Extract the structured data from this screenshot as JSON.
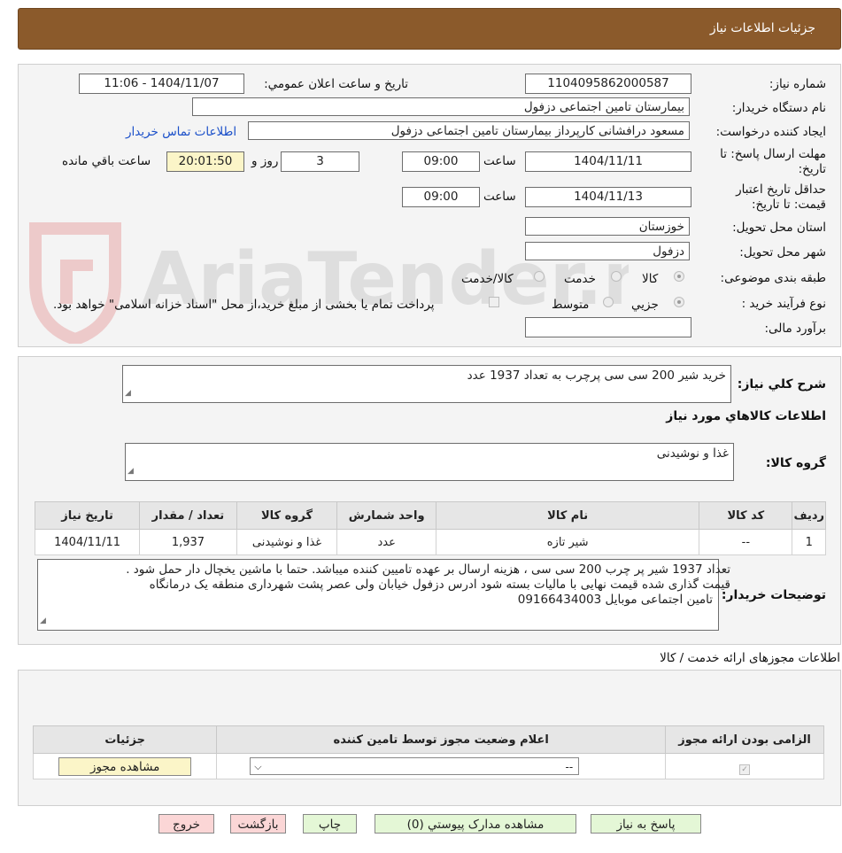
{
  "header": {
    "title": "جزئیات اطلاعات نیاز"
  },
  "fields": {
    "need_number_label": "شماره نیاز:",
    "need_number": "1104095862000587",
    "announce_label": "تاریخ و ساعت اعلان عمومي:",
    "announce_value": "1404/11/07 - 11:06",
    "buyer_org_label": "نام دستگاه خریدار:",
    "buyer_org": "بیمارستان تامین اجتماعی دزفول",
    "creator_label": "ایجاد کننده درخواست:",
    "creator": "مسعود درافشانی کارپرداز بیمارستان تامین اجتماعی دزفول",
    "contact_link": "اطلاعات تماس خریدار",
    "deadline_label_1": "مهلت ارسال پاسخ: تا",
    "deadline_label_2": "تاریخ:",
    "deadline_date": "1404/11/11",
    "time_label": "ساعت",
    "deadline_time": "09:00",
    "days_value": "3",
    "days_label": "روز و",
    "remaining_time": "20:01:50",
    "remaining_label": "ساعت باقي مانده",
    "validity_label_1": "حداقل تاریخ اعتبار",
    "validity_label_2": "قیمت: تا تاریخ:",
    "validity_date": "1404/11/13",
    "validity_time": "09:00",
    "province_label": "استان محل تحویل:",
    "province": "خوزستان",
    "city_label": "شهر محل تحویل:",
    "city": "دزفول",
    "category_label": "طبقه بندی موضوعی:",
    "cat_goods": "کالا",
    "cat_service": "خدمت",
    "cat_both": "کالا/خدمت",
    "process_label": "نوع فرآیند خرید :",
    "proc_partial": "جزیي",
    "proc_medium": "متوسط",
    "payment_note": "پرداخت تمام یا بخشی از مبلغ خرید،از محل \"اسناد خزانه اسلامی\" خواهد بود.",
    "budget_label": "برآورد مالی:",
    "budget_value": ""
  },
  "summary": {
    "label": "شرح کلي نياز:",
    "text": "خرید شیر 200 سی سی پرچرب به تعداد 1937 عدد",
    "goods_info_title": "اطلاعات کالاهاي مورد نياز",
    "group_label": "گروه کالا:",
    "group_text": "غذا و نوشیدنی"
  },
  "goods_table": {
    "headers": [
      "رديف",
      "کد کالا",
      "نام کالا",
      "واحد شمارش",
      "گروه کالا",
      "تعداد / مقدار",
      "تاریخ نیاز"
    ],
    "rows": [
      [
        "1",
        "--",
        "شیر تازه",
        "عدد",
        "غذا و نوشیدنی",
        "1,937",
        "1404/11/11"
      ]
    ]
  },
  "buyer_notes": {
    "label": "توضیحات خریدار:",
    "line1": "تعداد 1937 شیر پر چرب 200 سی سی ، هزینه ارسال بر عهده تامیین کننده میباشد. حتما با ماشین یخچال دار حمل شود .",
    "line2": "قیمت گذاری شده قیمت نهایی با مالیات بسته شود ادرس دزفول خیابان ولی عصر پشت شهرداری منطقه یک درمانگاه",
    "line3": "تامین اجتماعی  موبایل 09166434003"
  },
  "permits": {
    "title": "اطلاعات مجوزهای ارائه خدمت / کالا",
    "headers": [
      "الزامی بودن ارائه مجوز",
      "اعلام وضعیت مجوز توسط تامین کننده",
      "جزئیات"
    ],
    "select_value": "--",
    "view_button": "مشاهده مجوز"
  },
  "actions": {
    "reply": "پاسخ به نیاز",
    "attachments": "مشاهده مدارک پیوستي (0)",
    "print": "چاپ",
    "back": "بازگشت",
    "exit": "خروج"
  },
  "watermark": {
    "text": "AriaTender.neT"
  }
}
